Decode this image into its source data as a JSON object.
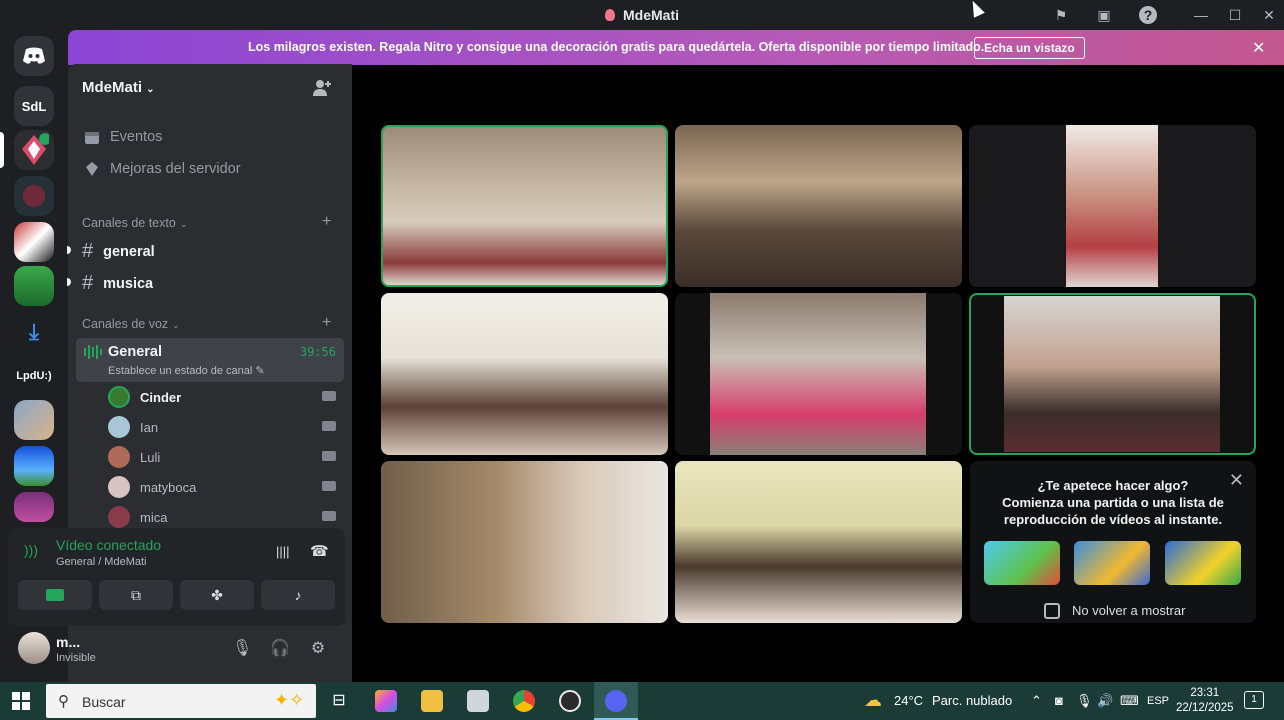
{
  "window": {
    "title": "MdeMati"
  },
  "banner": {
    "text": "Los milagros existen. Regala Nitro y consigue una decoración gratis para quedártela. Oferta disponible por tiempo limitado.",
    "button": "Echa un vistazo"
  },
  "guilds": [
    {
      "label": "",
      "icon": "discord-home-icon"
    },
    {
      "label": "SdL",
      "icon": ""
    },
    {
      "label": "",
      "icon": "server-icon"
    },
    {
      "label": "LpdU:)",
      "icon": ""
    }
  ],
  "server": {
    "name": "MdeMati",
    "nav": [
      "Eventos",
      "Mejoras del servidor"
    ],
    "text_section": "Canales de texto",
    "text_channels": [
      "general",
      "musica"
    ],
    "voice_section": "Canales de voz",
    "voice_channel": {
      "name": "General",
      "time": "39:56",
      "status_placeholder": "Establece un estado de canal"
    },
    "voice_users": [
      "Cinder",
      "Ian",
      "Luli",
      "matyboca",
      "mica"
    ]
  },
  "connection": {
    "status": "Vídeo conectado",
    "location": "General / MdeMati"
  },
  "user": {
    "name": "m...",
    "status": "Invisible"
  },
  "activity": {
    "prompt_line1": "¿Te apetece hacer algo?",
    "prompt_line2": "Comienza una partida o una lista de",
    "prompt_line3": "reproducción de vídeos al instante.",
    "checkbox_label": "No volver a mostrar"
  },
  "taskbar": {
    "search_placeholder": "Buscar",
    "weather_temp": "24°C",
    "weather_desc": "Parc. nublado",
    "lang": "ESP",
    "time": "23:31",
    "date": "22/12/2025",
    "notif_count": "1"
  },
  "colors": {
    "accent_green": "#23a55a",
    "sidebar": "#2b2d31",
    "taskbar": "#1b3b37"
  }
}
